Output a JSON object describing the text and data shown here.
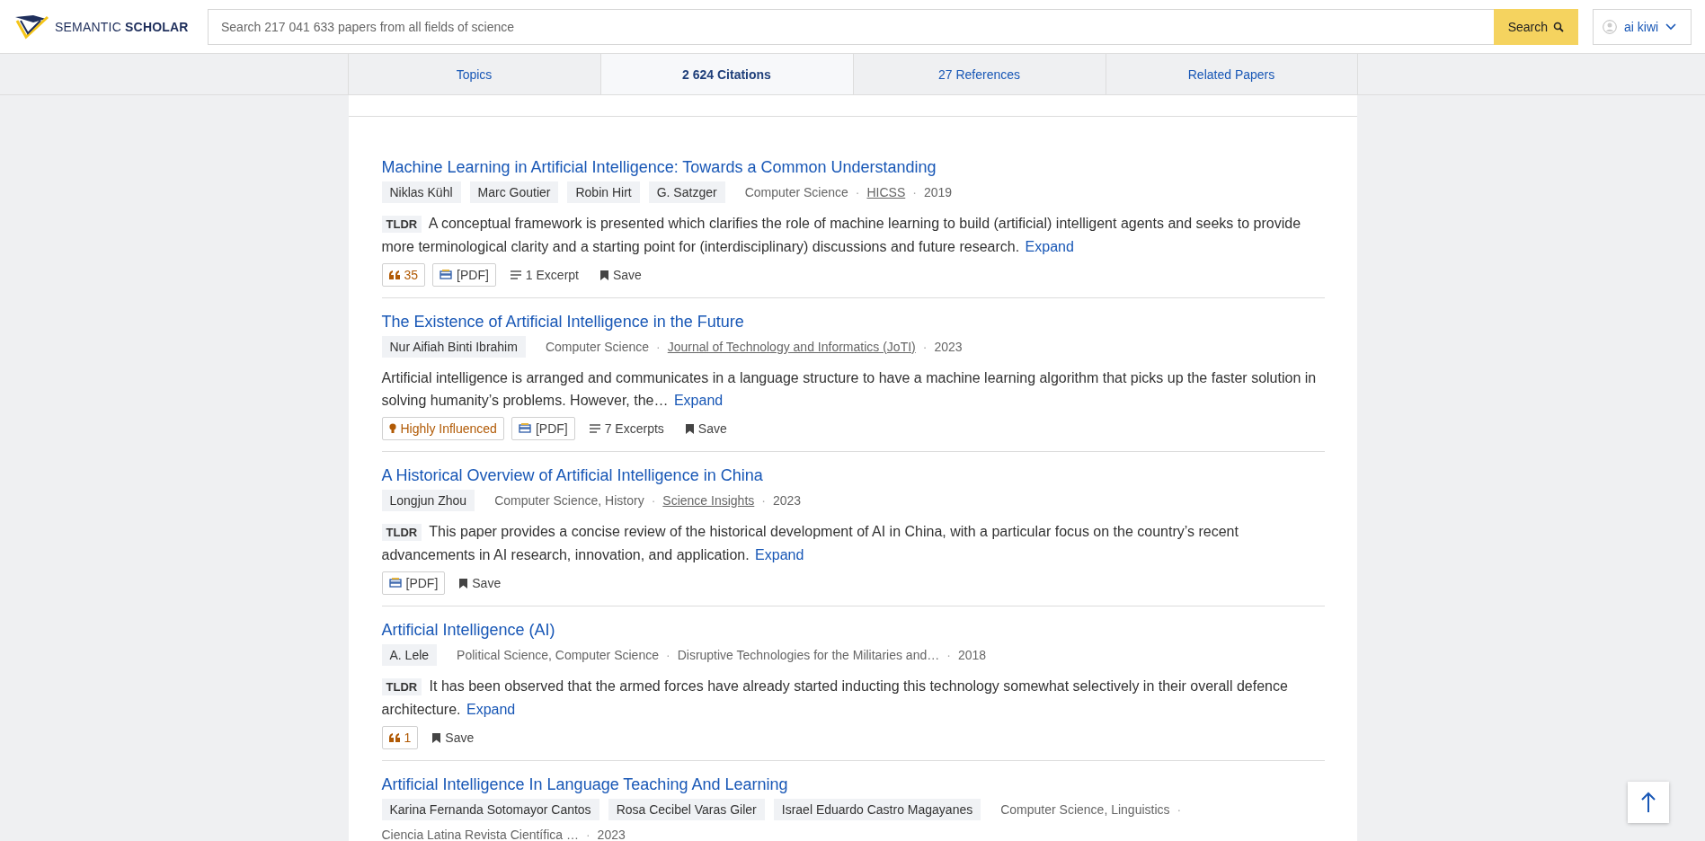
{
  "header": {
    "logo": "SEMANTIC **SCHOLAR**",
    "search": {
      "placeholder": "Search 217 041 633 papers from all fields of science"
    },
    "search_button": "Search",
    "user": "ai kiwi"
  },
  "tabs": [
    {
      "label": "Topics",
      "selected": false
    },
    {
      "label": "2 624 Citations",
      "selected": true
    },
    {
      "label": "27 References",
      "selected": false
    },
    {
      "label": "Related Papers",
      "selected": false
    }
  ],
  "papers": [
    {
      "title": "Machine Learning in Artificial Intelligence: Towards a Common Understanding",
      "authors": [
        "Niklas Kühl",
        "Marc Goutier",
        "Robin Hirt",
        "G. Satzger"
      ],
      "fields": "Computer Science",
      "separator": "·",
      "venue": "HICSS",
      "venue_linked": true,
      "year": "2019",
      "tldr": "TLDR",
      "summary": "A conceptual framework is presented which clarifies the role of machine learning to build (artificial) intelligent agents and seeks to provide more terminological clarity and a starting point for (interdisciplinary) discussions and future research.",
      "expand": "Expand",
      "actions": [
        {
          "kind": "citations",
          "label": "35"
        },
        {
          "kind": "pdf",
          "label": "[PDF]"
        },
        {
          "kind": "excerpts",
          "label": "1 Excerpt"
        },
        {
          "kind": "save",
          "label": "Save"
        }
      ]
    },
    {
      "title": "The Existence of Artificial Intelligence in the Future",
      "authors": [
        "Nur Aifiah Binti Ibrahim"
      ],
      "fields": "Computer Science",
      "separator": "·",
      "venue": "Journal of Technology and Informatics (JoTI)",
      "venue_linked": true,
      "year": "2023",
      "summary": "Artificial intelligence is arranged and communicates in a language structure to have a machine learning algorithm that picks up the faster solution in solving humanity’s problems. However, the…",
      "expand": "Expand",
      "actions": [
        {
          "kind": "influenced",
          "label": "Highly Influenced"
        },
        {
          "kind": "pdf",
          "label": "[PDF]"
        },
        {
          "kind": "excerpts",
          "label": "7 Excerpts"
        },
        {
          "kind": "save",
          "label": "Save"
        }
      ]
    },
    {
      "title": "A Historical Overview of Artificial Intelligence in China",
      "authors": [
        "Longjun Zhou"
      ],
      "fields": "Computer Science, History",
      "separator": "·",
      "venue": "Science Insights",
      "venue_linked": true,
      "year": "2023",
      "tldr": "TLDR",
      "summary": "This paper provides a concise review of the historical development of AI in China, with a particular focus on the country’s recent advancements in AI research, innovation, and application.",
      "expand": "Expand",
      "actions": [
        {
          "kind": "pdf",
          "label": "[PDF]"
        },
        {
          "kind": "save",
          "label": "Save"
        }
      ]
    },
    {
      "title": "Artificial Intelligence (AI)",
      "authors": [
        "A. Lele"
      ],
      "fields": "Political Science, Computer Science",
      "separator": "·",
      "venue": "Disruptive Technologies for the Militaries and…",
      "venue_linked": false,
      "year": "2018",
      "tldr": "TLDR",
      "summary": "It has been observed that the armed forces have already started inducting this technology somewhat selectively in their overall defence architecture.",
      "expand": "Expand",
      "actions": [
        {
          "kind": "citations",
          "label": "1"
        },
        {
          "kind": "save",
          "label": "Save"
        }
      ]
    },
    {
      "title": "Artificial Intelligence In Language Teaching And Learning",
      "authors": [
        "Karina Fernanda Sotomayor Cantos",
        "Rosa Cecibel Varas Giler",
        "Israel Eduardo Castro Magayanes"
      ],
      "fields": "Computer Science, Linguistics",
      "separator": "·",
      "venue": "Ciencia Latina Revista Científica …",
      "venue_linked": false,
      "year": "2023"
    }
  ]
}
